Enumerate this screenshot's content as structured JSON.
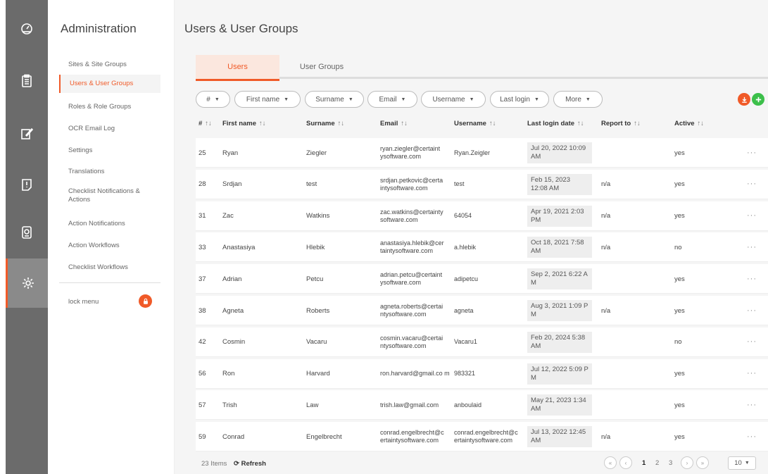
{
  "sidebar": {
    "title": "Administration",
    "items": [
      {
        "label": "Sites & Site Groups",
        "active": false
      },
      {
        "label": "Users & User Groups",
        "active": true
      },
      {
        "label": "Roles & Role Groups",
        "active": false
      },
      {
        "label": "OCR Email Log",
        "active": false
      },
      {
        "label": "Settings",
        "active": false
      },
      {
        "label": "Translations",
        "active": false
      },
      {
        "label": "Checklist Notifications & Actions",
        "active": false
      },
      {
        "label": "Action Notifications",
        "active": false
      },
      {
        "label": "Action Workflows",
        "active": false
      },
      {
        "label": "Checklist Workflows",
        "active": false
      }
    ],
    "lock_label": "lock menu"
  },
  "rail": {
    "icons": [
      "dashboard-icon",
      "clipboard-icon",
      "edit-icon",
      "alert-icon",
      "timer-icon",
      "settings-icon"
    ],
    "active": "settings-icon"
  },
  "page": {
    "title": "Users & User Groups",
    "tabs": [
      {
        "label": "Users",
        "active": true
      },
      {
        "label": "User Groups",
        "active": false
      }
    ]
  },
  "filters": [
    "#",
    "First name",
    "Surname",
    "Email",
    "Username",
    "Last login",
    "More"
  ],
  "table": {
    "sort_glyph": "↑↓",
    "headers": [
      "#",
      "First name",
      "Surname",
      "Email",
      "Username",
      "Last login date",
      "Report to",
      "Active"
    ],
    "rows": [
      {
        "id": "25",
        "first": "Ryan",
        "surname": "Ziegler",
        "email": "ryan.ziegler@certaint ysoftware.com",
        "username": "Ryan.Zeigler",
        "last_login": "Jul 20, 2022 10:09 AM",
        "report_to": "",
        "active": "yes",
        "more": "···"
      },
      {
        "id": "28",
        "first": "Srdjan",
        "surname": "test",
        "email": "srdjan.petkovic@certa intysoftware.com",
        "username": "test",
        "last_login": "Feb 15, 2023 12:08 AM",
        "report_to": "n/a",
        "active": "yes",
        "more": "···"
      },
      {
        "id": "31",
        "first": "Zac",
        "surname": "Watkins",
        "email": "zac.watkins@certainty software.com",
        "username": "64054",
        "last_login": "Apr 19, 2021 2:03 PM",
        "report_to": "n/a",
        "active": "yes",
        "more": "···"
      },
      {
        "id": "33",
        "first": "Anastasiya",
        "surname": "Hlebik",
        "email": "anastasiya.hlebik@cer taintysoftware.com",
        "username": "a.hlebik",
        "last_login": "Oct 18, 2021 7:58 AM",
        "report_to": "n/a",
        "active": "no",
        "more": "···"
      },
      {
        "id": "37",
        "first": "Adrian",
        "surname": "Petcu",
        "email": "adrian.petcu@certaint ysoftware.com",
        "username": "adipetcu",
        "last_login": "Sep 2, 2021 6:22 A M",
        "report_to": "",
        "active": "yes",
        "more": "···"
      },
      {
        "id": "38",
        "first": "Agneta",
        "surname": "Roberts",
        "email": "agneta.roberts@certai ntysoftware.com",
        "username": "agneta",
        "last_login": "Aug 3, 2021 1:09 P M",
        "report_to": "n/a",
        "active": "yes",
        "more": "···"
      },
      {
        "id": "42",
        "first": "Cosmin",
        "surname": "Vacaru",
        "email": "cosmin.vacaru@certai ntysoftware.com",
        "username": "Vacaru1",
        "last_login": "Feb 20, 2024 5:38 AM",
        "report_to": "",
        "active": "no",
        "more": "···"
      },
      {
        "id": "56",
        "first": "Ron",
        "surname": "Harvard",
        "email": "ron.harvard@gmail.co m",
        "username": "983321",
        "last_login": "Jul 12, 2022 5:09 P M",
        "report_to": "",
        "active": "yes",
        "more": "···"
      },
      {
        "id": "57",
        "first": "Trish",
        "surname": "Law",
        "email": "trish.law@gmail.com",
        "username": "anboulaid",
        "last_login": "May 21, 2023 1:34 AM",
        "report_to": "",
        "active": "yes",
        "more": "···"
      },
      {
        "id": "59",
        "first": "Conrad",
        "surname": "Engelbrecht",
        "email": "conrad.engelbrecht@c ertaintysoftware.com",
        "username": "conrad.engelbrecht@c ertaintysoftware.com",
        "last_login": "Jul 13, 2022 12:45 AM",
        "report_to": "n/a",
        "active": "yes",
        "more": "···"
      }
    ]
  },
  "footer": {
    "items_count": "23 Items",
    "refresh_label": "Refresh",
    "pages": [
      "1",
      "2",
      "3"
    ],
    "current_page": "1",
    "first_glyph": "«",
    "prev_glyph": "‹",
    "next_glyph": "›",
    "last_glyph": "»",
    "per_page": "10"
  },
  "colors": {
    "accent": "#f05a28",
    "add": "#3cbf4a",
    "rail": "#6b6b6b"
  }
}
